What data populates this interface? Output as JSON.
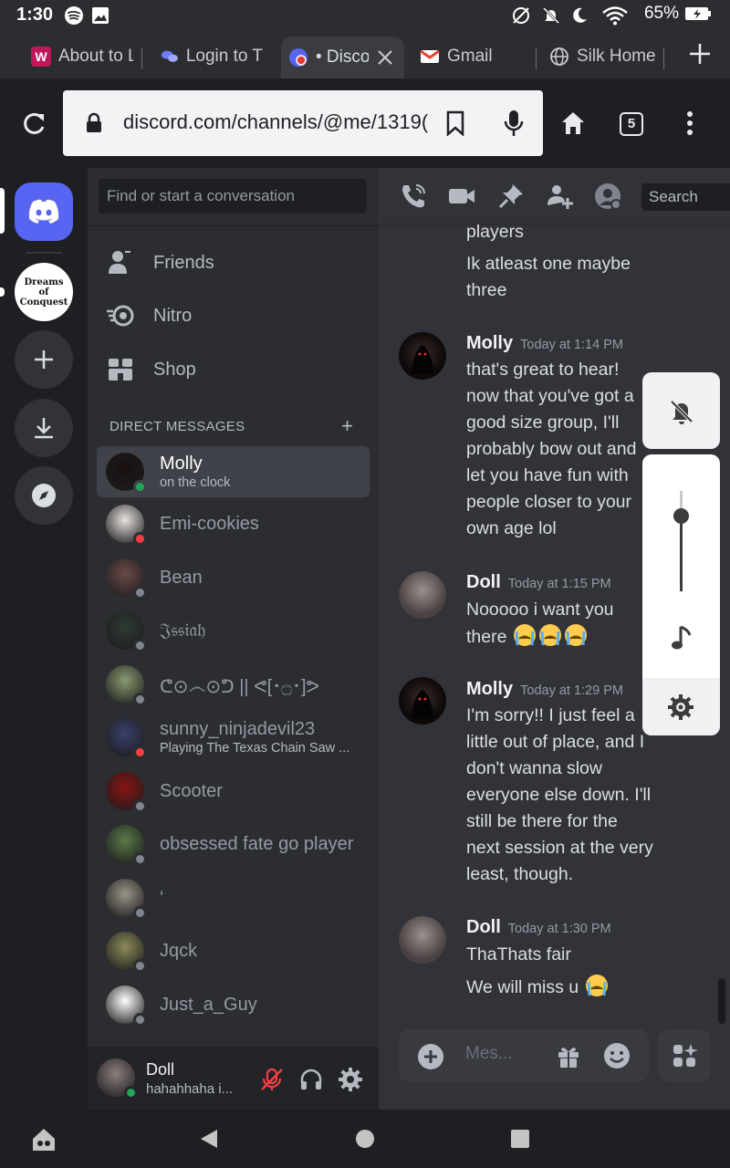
{
  "status_bar": {
    "time": "1:30",
    "battery": "65%"
  },
  "tabs": [
    {
      "label": "About to L",
      "favicon": "W",
      "favicon_color": "#e0245e"
    },
    {
      "label": "Login to T",
      "favicon": "chat-bubbles",
      "favicon_color": "#5865f2"
    },
    {
      "label": "• Discor",
      "favicon": "discord",
      "favicon_color": "#5865f2",
      "active": true
    },
    {
      "label": "Gmail",
      "favicon": "M",
      "favicon_color": "#ea4335"
    },
    {
      "label": "Silk Home",
      "favicon": "globe",
      "favicon_color": "#c9cbcf"
    }
  ],
  "toolbar": {
    "url": "discord.com/channels/@me/1319(",
    "tab_count": "5"
  },
  "guilds": [
    {
      "name": "Discord home",
      "color": "#5865f2"
    },
    {
      "name": "Dreams of Conquest",
      "text": "Dreams of Conquest"
    }
  ],
  "dm_panel": {
    "search_placeholder": "Find or start a conversation",
    "nav": [
      {
        "label": "Friends",
        "icon": "friends-icon"
      },
      {
        "label": "Nitro",
        "icon": "nitro-icon"
      },
      {
        "label": "Shop",
        "icon": "shop-icon"
      }
    ],
    "header": "DIRECT MESSAGES",
    "dms": [
      {
        "name": "Molly",
        "sub": "on the clock",
        "status": "online",
        "status_color": "#23a55a",
        "avatar_color": "#1a1010",
        "selected": true
      },
      {
        "name": "Emi-cookies",
        "sub": "",
        "status": "dnd",
        "status_color": "#f23f43",
        "avatar_color": "#e8e2e0"
      },
      {
        "name": "Bean",
        "sub": "",
        "status": "offline",
        "status_color": "#80848e",
        "avatar_color": "#6b4a4a"
      },
      {
        "name": "𝔍𝔰𝔰𝔦𝔞𝔥",
        "sub": "",
        "status": "offline",
        "status_color": "#80848e",
        "avatar_color": "#2f3a33"
      },
      {
        "name": "ᕦ⊙෴⊙ᕤ || ᕙ[･۝･]ᕗ",
        "sub": "",
        "status": "offline",
        "status_color": "#80848e",
        "avatar_color": "#8a9a70"
      },
      {
        "name": "sunny_ninjadevil23",
        "sub": "Playing The Texas Chain Saw ...",
        "status": "dnd",
        "status_color": "#f23f43",
        "avatar_color": "#3a3f6a"
      },
      {
        "name": "Scooter",
        "sub": "",
        "status": "offline",
        "status_color": "#80848e",
        "avatar_color": "#8a1414"
      },
      {
        "name": "obsessed fate go player",
        "sub": "",
        "status": "offline",
        "status_color": "#80848e",
        "avatar_color": "#5a7a4a"
      },
      {
        "name": "‘",
        "sub": "",
        "status": "offline",
        "status_color": "#80848e",
        "avatar_color": "#9a9488"
      },
      {
        "name": "Jqck",
        "sub": "",
        "status": "offline",
        "status_color": "#80848e",
        "avatar_color": "#8c8a5a"
      },
      {
        "name": "Just_a_Guy",
        "sub": "",
        "status": "offline",
        "status_color": "#80848e",
        "avatar_color": "#ffffff"
      }
    ]
  },
  "user_panel": {
    "name": "Doll",
    "status_text": "hahahhaha i..."
  },
  "chat": {
    "search_placeholder": "Search",
    "lead_lines": [
      "players",
      "Ik atleast one maybe three"
    ],
    "messages": [
      {
        "author": "Molly",
        "time": "Today at 1:14 PM",
        "avatar_color": "#1a1010",
        "text": "that's great to hear! now that you've got a good size group, I'll probably bow out and let you have fun with people closer to your own age lol"
      },
      {
        "author": "Doll",
        "time": "Today at 1:15 PM",
        "avatar_color": "#5a5050",
        "text": "Nooooo i want you there"
      },
      {
        "author": "Molly",
        "time": "Today at 1:29 PM",
        "avatar_color": "#1a1010",
        "text": "I'm sorry!! I just feel a little out of place, and I don't wanna slow everyone else down. I'll still be there for the next session at the very least, though."
      },
      {
        "author": "Doll",
        "time": "Today at 1:30 PM",
        "avatar_color": "#5a5050",
        "text": "ThaThats fair",
        "extra": "We will miss u"
      }
    ],
    "composer_placeholder": "Mes..."
  },
  "colors": {
    "accent": "#5865f2",
    "online": "#23a55a",
    "dnd": "#f23f43",
    "muted_red": "#f23f43"
  }
}
